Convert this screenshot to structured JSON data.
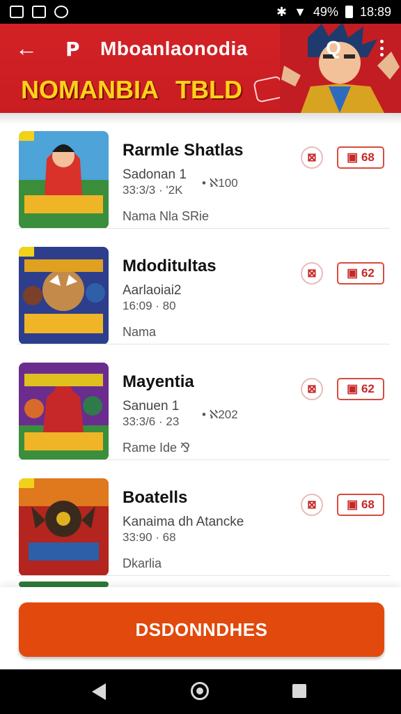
{
  "status_bar": {
    "battery": "49%",
    "time": "18:89"
  },
  "header": {
    "logo_mark": "P",
    "title": "Mboanlaonodia",
    "banner_left": "NOMANBIA",
    "banner_right": "TBLD",
    "back_icon": "arrow-left-icon",
    "search_icon": "search-icon",
    "more_icon": "more-vert-icon"
  },
  "items": [
    {
      "title": "Rarmle Shatlas",
      "sub1": "Sadonan 1",
      "sub2": "33:3/3  ·  '2K",
      "extra": "• ℵ100",
      "desc": "Nama Nla SRie",
      "download": "68"
    },
    {
      "title": "Mdoditultas",
      "sub1": "Aarlaoiai2",
      "sub2": "16:09  ·  80",
      "extra": "",
      "desc": "Nama",
      "download": "62"
    },
    {
      "title": "Mayentia",
      "sub1": "Sanuen 1",
      "sub2": "33:3/6  ·  23",
      "extra": "• ℵ202",
      "desc": "Rame Ide ⅋",
      "download": "62"
    },
    {
      "title": "Boatells",
      "sub1": "Kanaima dh Atancke",
      "sub2": "33:90  ·  68",
      "extra": "",
      "desc": "Dkarlia",
      "download": "68"
    }
  ],
  "action_button": {
    "label": "DSDONNDHES"
  },
  "colors": {
    "header_red": "#d32226",
    "accent_orange": "#e2490c",
    "banner_yellow": "#ffd21a"
  }
}
